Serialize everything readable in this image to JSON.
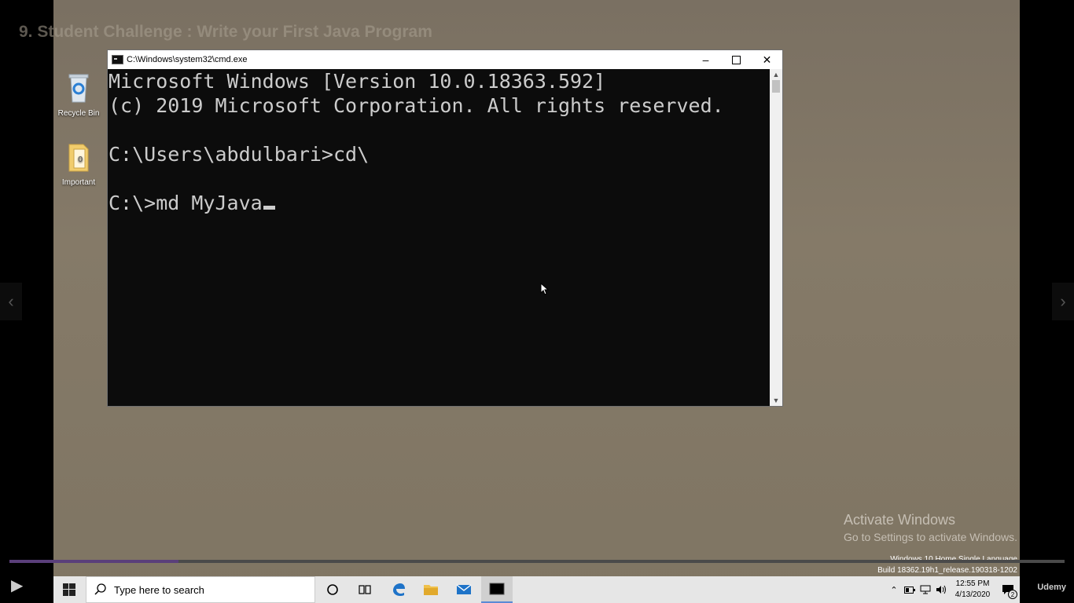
{
  "course": {
    "lecture_title": "9. Student Challenge : Write your First Java Program"
  },
  "desktop": {
    "icons": [
      {
        "label": "Recycle Bin",
        "icon": "recycle-bin-icon"
      },
      {
        "label": "Important",
        "icon": "folder-icon"
      }
    ]
  },
  "cmd": {
    "title": "C:\\Windows\\system32\\cmd.exe",
    "lines": [
      "Microsoft Windows [Version 10.0.18363.592]",
      "(c) 2019 Microsoft Corporation. All rights reserved.",
      "",
      "C:\\Users\\abdulbari>cd\\",
      "",
      "C:\\>md MyJava"
    ]
  },
  "watermark": {
    "title": "Activate Windows",
    "subtitle": "Go to Settings to activate Windows.",
    "edition": "Windows 10 Home Single Language",
    "build": "Build 18362.19h1_release.190318-1202"
  },
  "taskbar": {
    "search_placeholder": "Type here to search",
    "time": "12:55 PM",
    "date": "4/13/2020",
    "notification_count": "2"
  },
  "video": {
    "progress_percent": 16,
    "brand": "Udemy"
  },
  "colors": {
    "console_bg": "#0c0c0c",
    "console_fg": "#cccccc",
    "taskbar_bg": "#e6e6e6",
    "progress": "#5a3f7a"
  }
}
